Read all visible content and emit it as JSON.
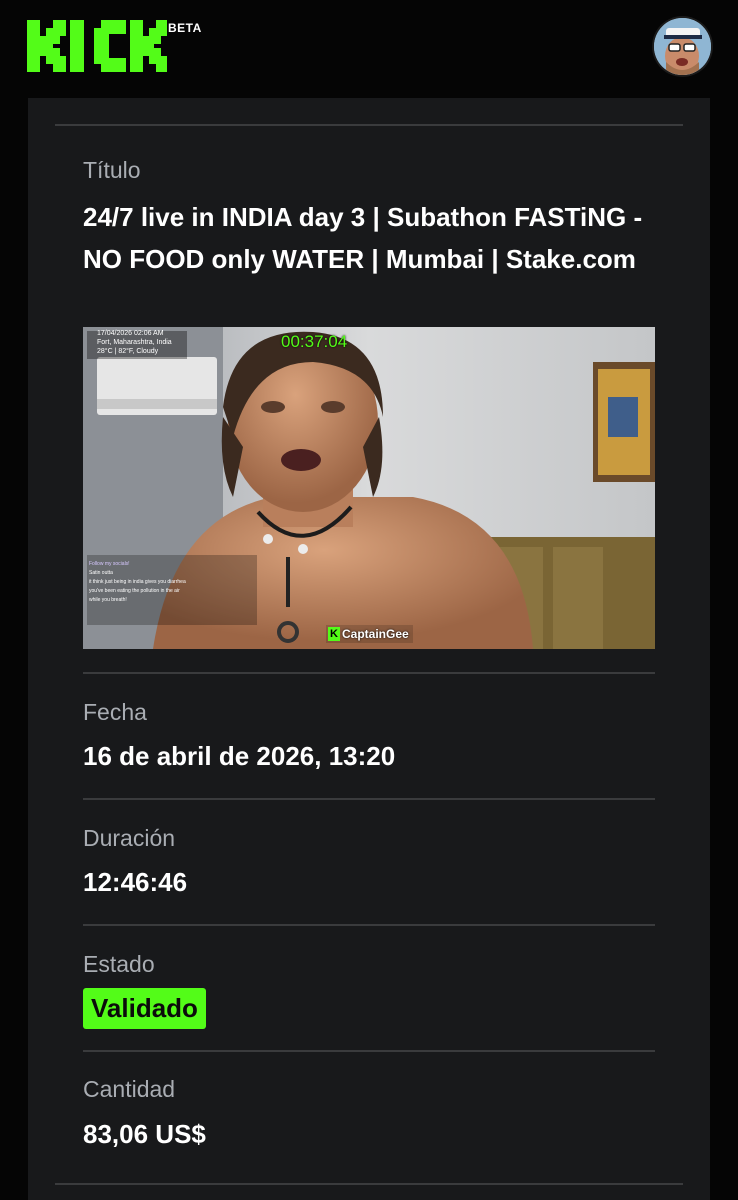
{
  "header": {
    "logo_text": "KICK",
    "beta_label": "BETA",
    "avatar_icon": "user-avatar",
    "brand_color": "#53fc18"
  },
  "details": {
    "title_label": "Título",
    "title_value": "24/7 live in INDIA day 3 | Subathon FASTiNG - NO FOOD only WATER | Mumbai | Stake.com",
    "date_label": "Fecha",
    "date_value": "16 de abril de 2026, 13:20",
    "duration_label": "Duración",
    "duration_value": "12:46:46",
    "status_label": "Estado",
    "status_value": "Validado",
    "amount_label": "Cantidad",
    "amount_value": "83,06 US$"
  },
  "thumbnail": {
    "datetime": "17/04/2026 02:06 AM",
    "location": "Fort, Maharashtra, India",
    "weather": "28°C | 82°F, Cloudy",
    "timer": "00:37:04",
    "watermark": "CaptainGee",
    "chat_lines": [
      "Follow my socials!",
      "Satin outta",
      "it think just being in india gives you diarrhea",
      "you've been eating the pollution in the air",
      "while you breath!"
    ]
  }
}
